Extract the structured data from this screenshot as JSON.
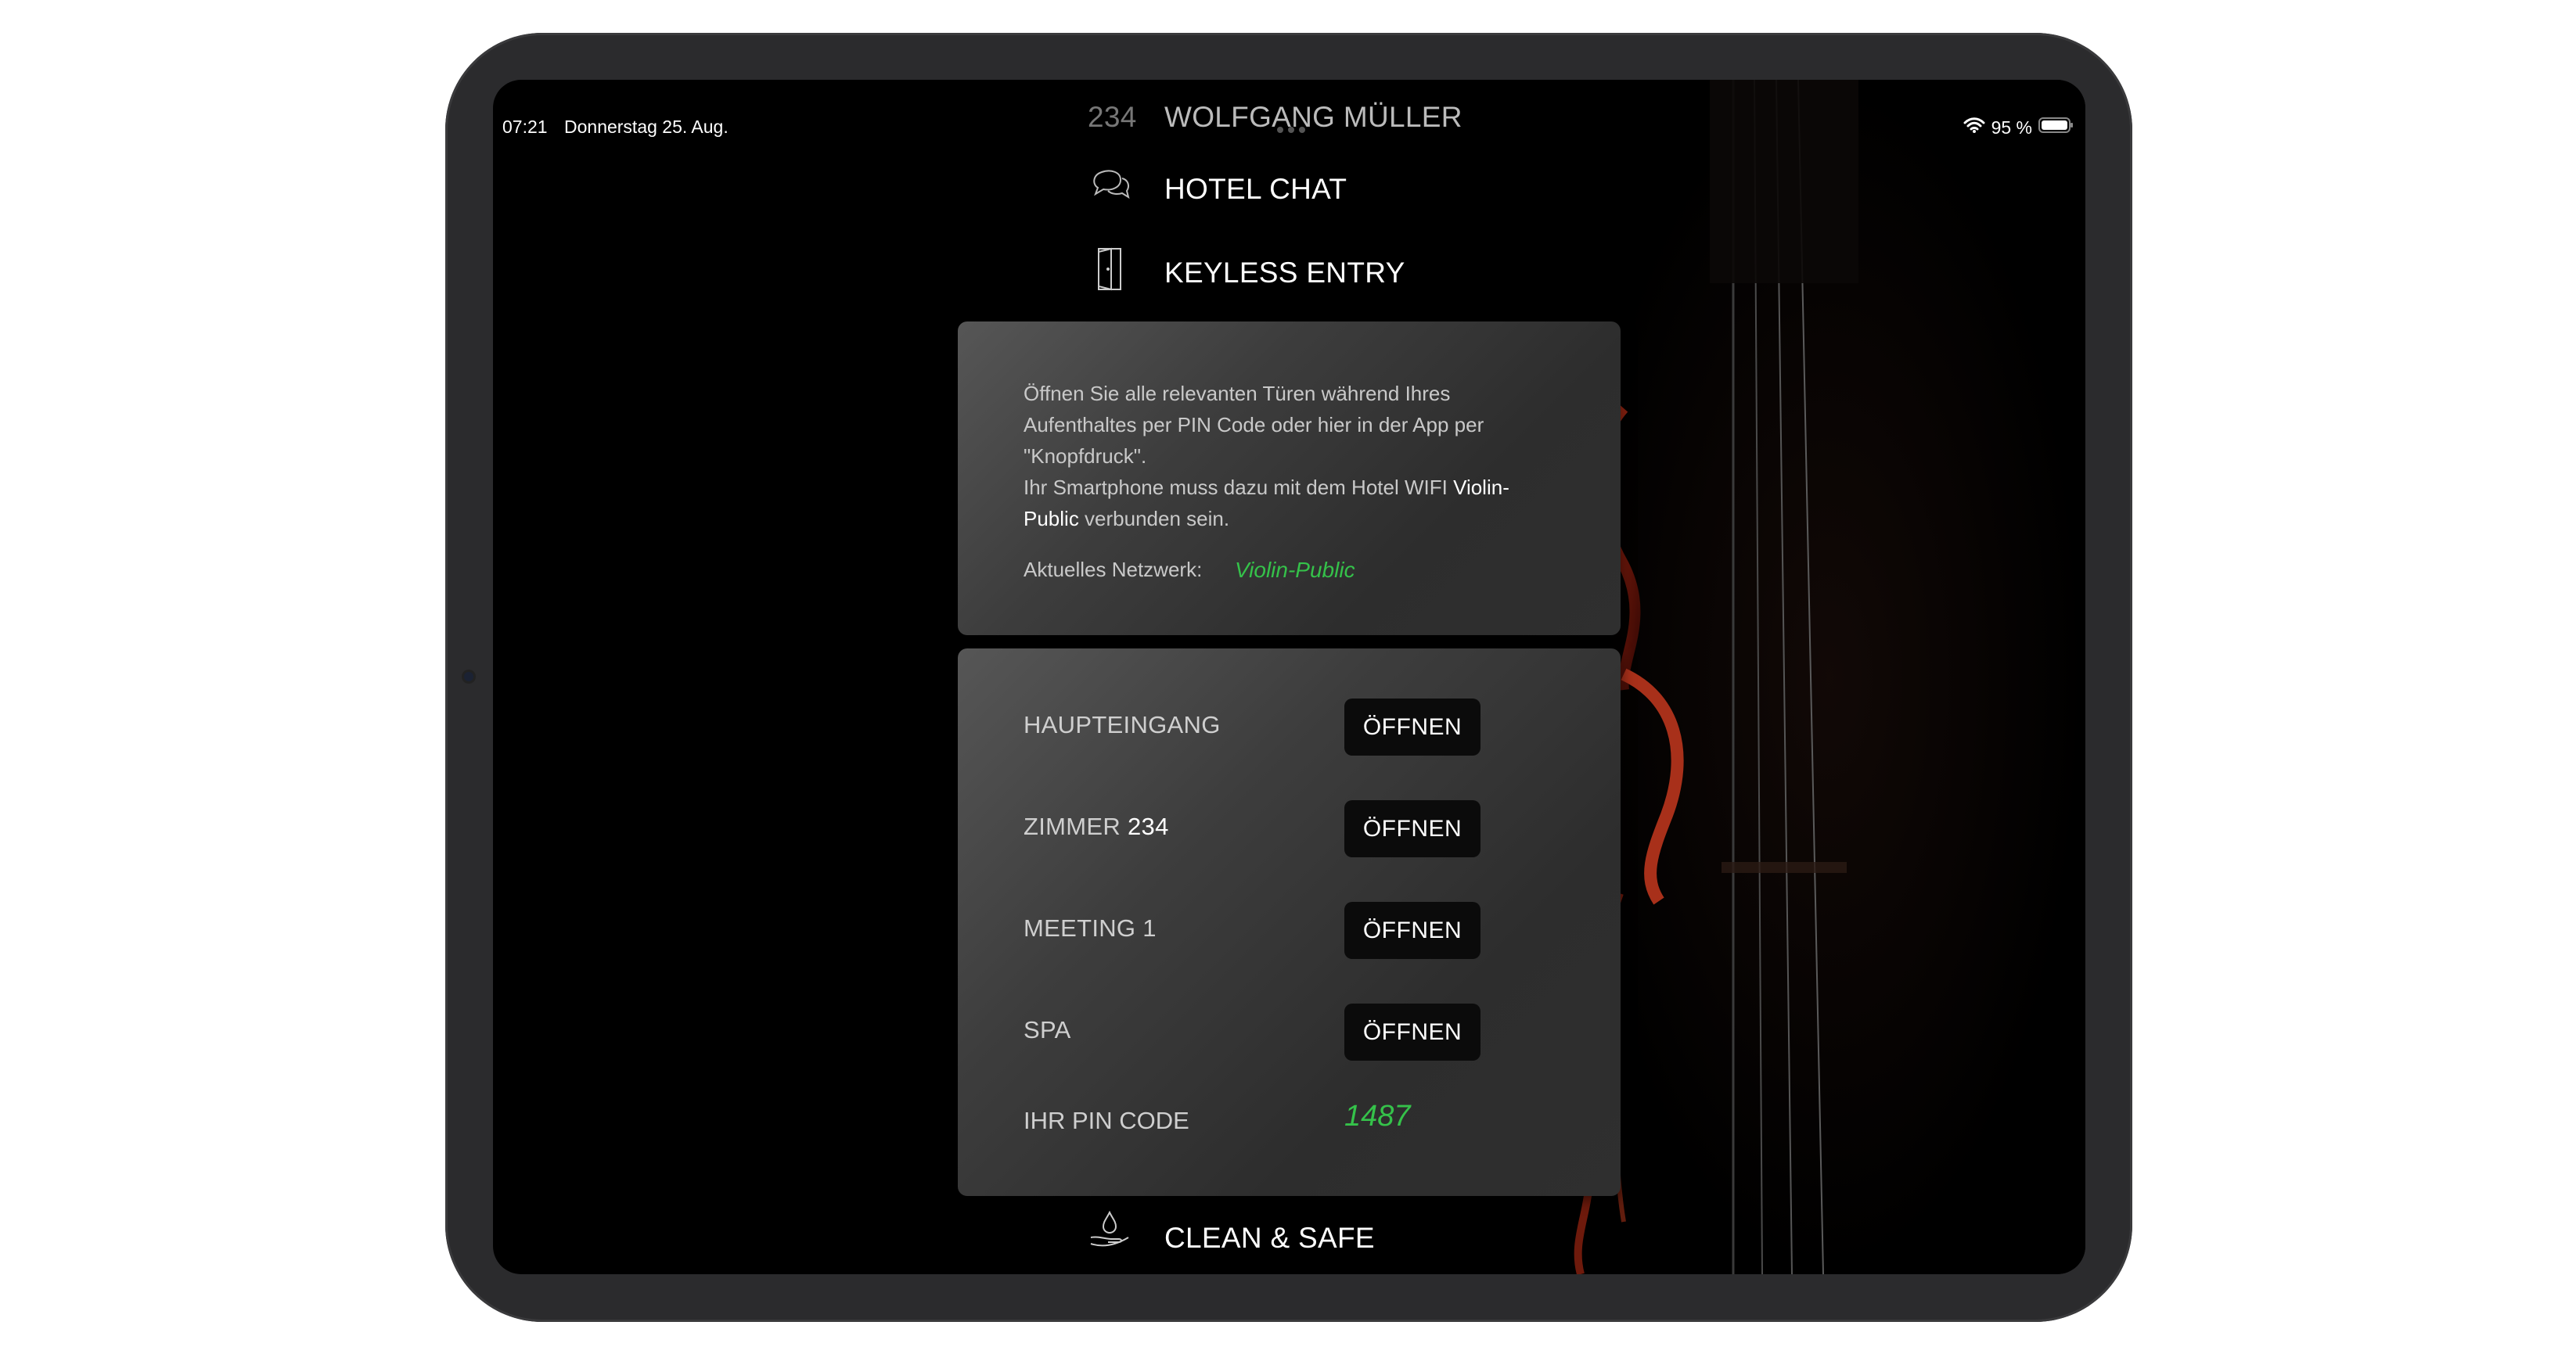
{
  "status": {
    "time": "07:21",
    "date": "Donnerstag 25. Aug.",
    "battery": "95 %"
  },
  "nav": {
    "top_partial_number": "234",
    "top_partial_name": "WOLFGANG MÜLLER",
    "hotel_chat": "HOTEL CHAT",
    "keyless_entry": "KEYLESS ENTRY",
    "clean_safe": "CLEAN & SAFE"
  },
  "info": {
    "line1": "Öffnen Sie alle relevanten Türen während Ihres Aufenthaltes per PIN Code oder hier in der App per \"Knopfdruck\".",
    "line2_prefix": "Ihr Smartphone muss dazu mit dem Hotel WIFI ",
    "wifi_name": "Violin-Public",
    "line2_suffix": " verbunden sein.",
    "network_label": "Aktuelles Netzwerk:",
    "network_value": "Violin-Public"
  },
  "doors": [
    {
      "label": "HAUPTEINGANG",
      "button": "ÖFFNEN"
    },
    {
      "label_prefix": "ZIMMER ",
      "label_number": "234",
      "button": "ÖFFNEN"
    },
    {
      "label": "MEETING 1",
      "button": "ÖFFNEN"
    },
    {
      "label": "SPA",
      "button": "ÖFFNEN"
    }
  ],
  "pin": {
    "label": "IHR PIN CODE",
    "value": "1487"
  },
  "colors": {
    "accent_green": "#35c24a",
    "background": "#000000"
  },
  "icons": [
    "chat-icon",
    "door-icon",
    "hand-water-icon",
    "wifi-icon",
    "battery-icon"
  ]
}
